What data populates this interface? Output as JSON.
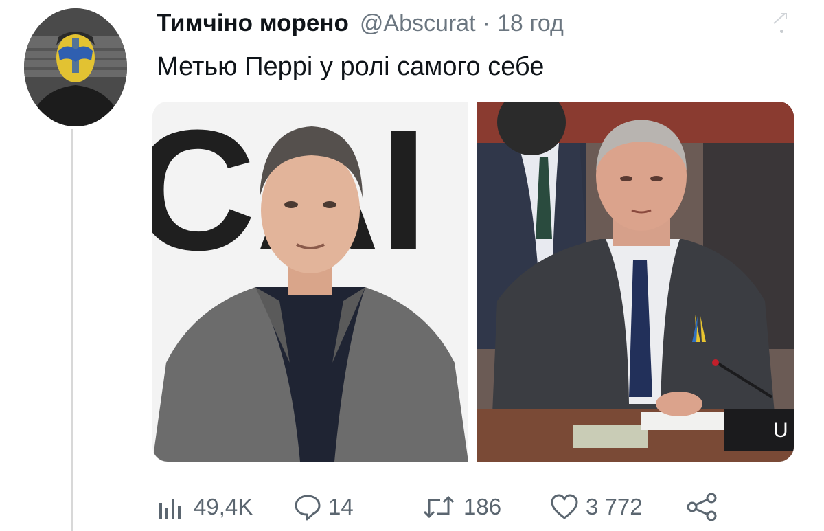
{
  "tweet": {
    "author_name": "Тимчіно морено",
    "author_handle": "@Abscurat",
    "separator": "·",
    "time_ago": "18 год",
    "text": "Метью Перрі у ролі самого себе"
  },
  "media": {
    "left_photo_backdrop_letters": "CAI",
    "right_photo_nameplate_letter": "U"
  },
  "actions": {
    "views": "49,4K",
    "replies": "14",
    "retweets": "186",
    "likes": "3 772"
  },
  "icons": {
    "views": "bar-chart-icon",
    "reply": "speech-bubble-icon",
    "retweet": "retweet-arrows-icon",
    "like": "heart-icon",
    "share": "share-nodes-icon",
    "more": "more-dots-icon"
  },
  "colors": {
    "text": "#0f1419",
    "secondary_text": "#6b7680",
    "ribbon_yellow": "#e8c530",
    "ribbon_blue": "#2f6fc2"
  }
}
